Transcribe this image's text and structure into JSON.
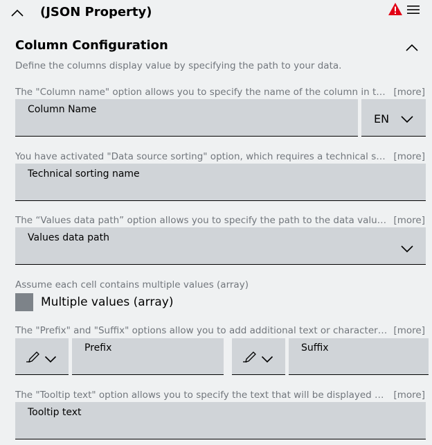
{
  "header": {
    "title": "(JSON Property)",
    "warning_color": "#e20015"
  },
  "section": {
    "title": "Column Configuration",
    "description": "Define the columns display value by specifying the path to your data."
  },
  "more_label": "[more]",
  "fields": {
    "column_name": {
      "hint": "The \"Column name\" option allows you to specify the name of the column in the table.",
      "label": "Column Name",
      "language": "EN"
    },
    "technical_sorting": {
      "hint": "You have activated \"Data source sorting\" option, which requires a technical sorting name.",
      "label": "Technical sorting name"
    },
    "values_path": {
      "hint": "The “Values data path” option allows you to specify the path to the data values.",
      "label": "Values data path"
    },
    "multiple": {
      "hint": "Assume each cell contains multiple values (array)",
      "label": "Multiple values (array)",
      "checked": false
    },
    "prefix_suffix": {
      "hint": "The \"Prefix\" and \"Suffix\" options allow you to add additional text or characters to values.",
      "prefix_label": "Prefix",
      "suffix_label": "Suffix"
    },
    "tooltip": {
      "hint": "The \"Tooltip text\" option allows you to specify the text that will be displayed as tooltip.",
      "label": "Tooltip text"
    }
  }
}
